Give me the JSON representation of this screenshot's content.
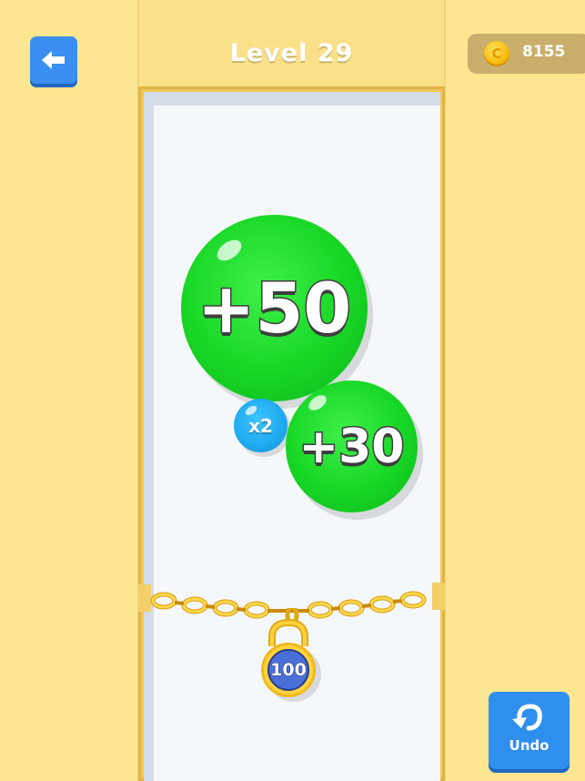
{
  "header": {
    "level_title": "Level 29",
    "coins": "8155",
    "coin_symbol": "C"
  },
  "balls": {
    "big": "+50",
    "medium": "+30",
    "multiplier": "x2"
  },
  "lock": {
    "value": "100"
  },
  "controls": {
    "undo_label": "Undo"
  },
  "colors": {
    "background": "#fde691",
    "green_ball": "#17d625",
    "blue_ball": "#1fa9ef",
    "button_blue": "#2f8fee"
  }
}
